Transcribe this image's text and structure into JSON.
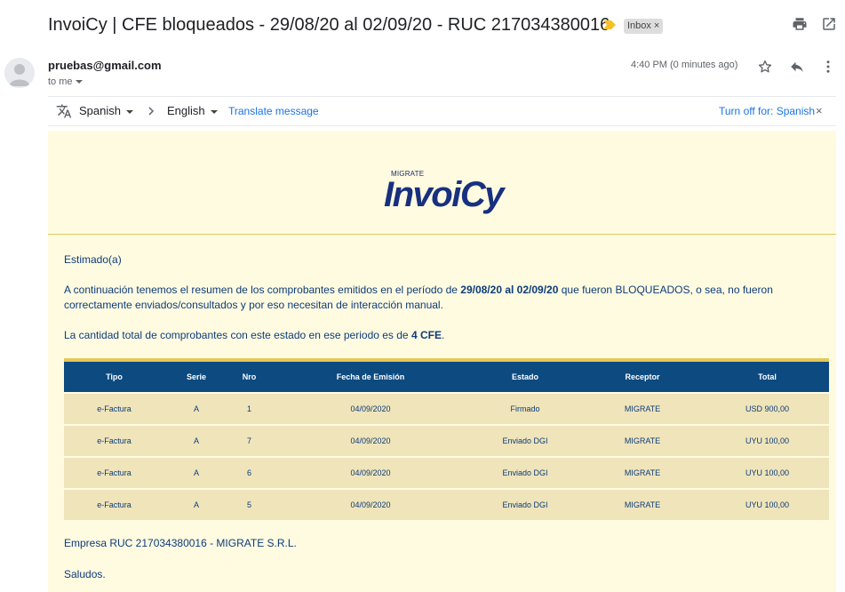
{
  "subject": {
    "title": "InvoiCy | CFE bloqueados - 29/08/20 al 02/09/20 - RUC 217034380016",
    "label": "Inbox",
    "label_close": "×"
  },
  "header": {
    "sender": "pruebas@gmail.com",
    "recipient": "to me",
    "time": "4:40 PM (0 minutes ago)"
  },
  "translate_bar": {
    "from_lang": "Spanish",
    "to_lang": "English",
    "translate_link": "Translate message",
    "turn_off": "Turn off for: Spanish",
    "close": "×"
  },
  "email": {
    "logo_small": "MIGRATE",
    "logo_main": "InvoiCy",
    "greeting": "Estimado(a)",
    "para1_pre": "A continuación tenemos el resumen de los comprobantes emitidos en el período de ",
    "para1_period": "29/08/20 al 02/09/20",
    "para1_post": " que fueron BLOQUEADOS, o sea, no fueron correctamente enviados/consultados y por eso necesitan de interacción manual.",
    "para2_pre": "La cantidad total de comprobantes con este estado en ese periodo es de ",
    "para2_count": "4 CFE",
    "para2_post": ".",
    "company": "Empresa RUC 217034380016 - MIGRATE S.R.L.",
    "closing": "Saludos."
  },
  "table": {
    "headers": [
      "Tipo",
      "Serie",
      "Nro",
      "Fecha de Emisión",
      "Estado",
      "Receptor",
      "Total"
    ],
    "rows": [
      [
        "e-Factura",
        "A",
        "1",
        "04/09/2020",
        "Firmado",
        "MIGRATE",
        "USD 900,00"
      ],
      [
        "e-Factura",
        "A",
        "7",
        "04/09/2020",
        "Enviado DGI",
        "MIGRATE",
        "UYU 100,00"
      ],
      [
        "e-Factura",
        "A",
        "6",
        "04/09/2020",
        "Enviado DGI",
        "MIGRATE",
        "UYU 100,00"
      ],
      [
        "e-Factura",
        "A",
        "5",
        "04/09/2020",
        "Enviado DGI",
        "MIGRATE",
        "UYU 100,00"
      ]
    ]
  },
  "icons": {
    "print": "print-icon",
    "popout": "open-in-new-window-icon",
    "star": "star-icon",
    "reply": "reply-icon",
    "more": "more-vertical-icon",
    "translate": "translate-icon",
    "importance": "importance-marker-icon"
  },
  "colors": {
    "email_bg": "#fffbe1",
    "table_header": "#0c4a80",
    "table_row": "#efe4ba",
    "accent_gold": "#e5c75a",
    "text_blue": "#0c3c7a",
    "link_blue": "#1a73e8"
  }
}
